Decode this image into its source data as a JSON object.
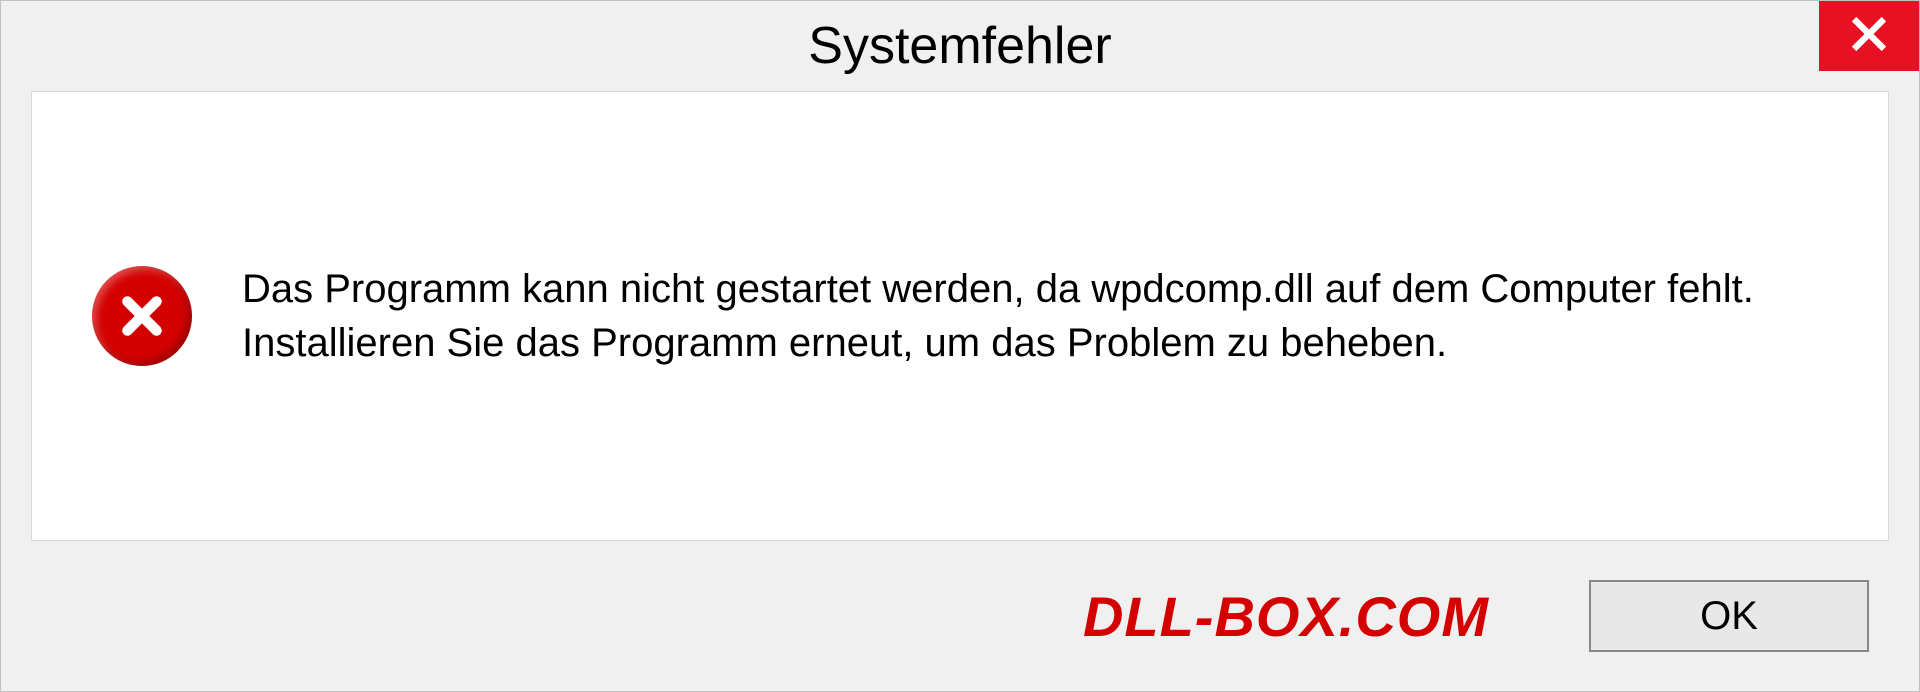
{
  "dialog": {
    "title": "Systemfehler",
    "message": "Das Programm kann nicht gestartet werden, da wpdcomp.dll auf dem Computer fehlt. Installieren Sie das Programm erneut, um das Problem zu beheben.",
    "ok_label": "OK"
  },
  "watermark": "DLL-BOX.COM"
}
